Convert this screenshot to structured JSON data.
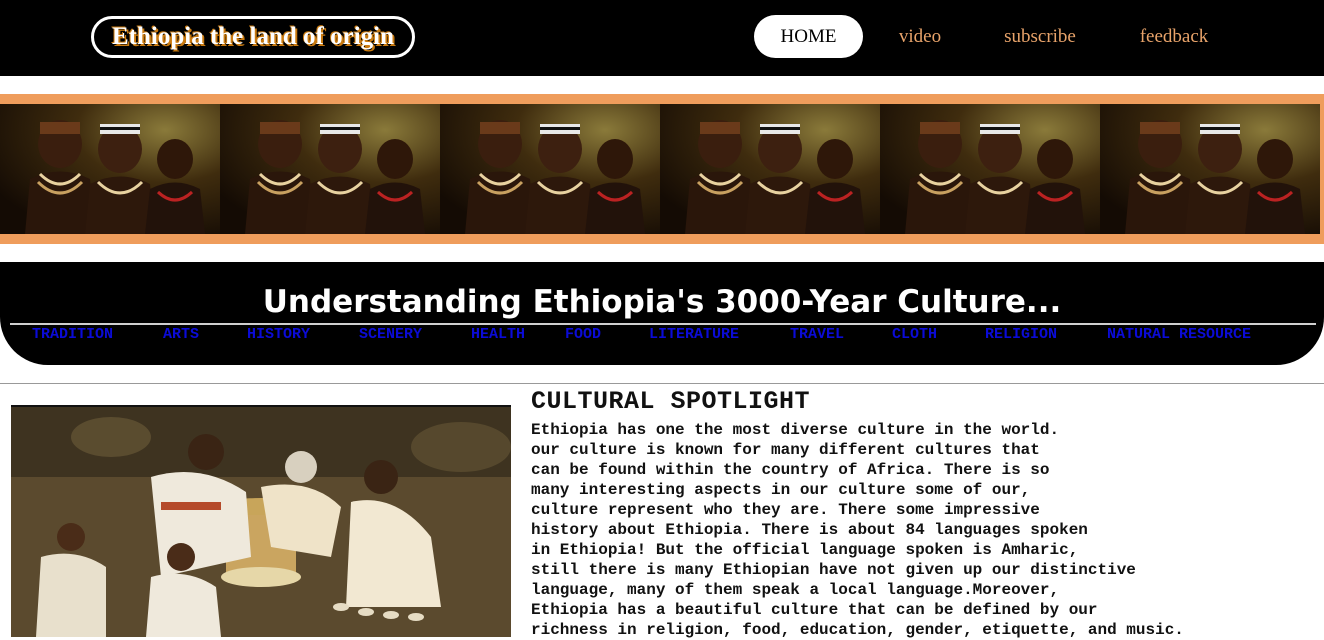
{
  "site": {
    "logo_text": "Ethiopia the land of origin"
  },
  "nav": {
    "items": [
      {
        "label": "HOME",
        "active": true
      },
      {
        "label": "video",
        "active": false
      },
      {
        "label": "subscribe",
        "active": false
      },
      {
        "label": "feedback",
        "active": false
      }
    ]
  },
  "culture": {
    "title": "Understanding Ethiopia's 3000-Year Culture...",
    "categories": [
      "TRADITION",
      "ARTS",
      "HISTORY",
      "SCENERY",
      "HEALTH",
      "FOOD",
      "LITERATURE",
      "TRAVEL",
      "CLOTH",
      "RELIGION",
      "NATURAL RESOURCE"
    ]
  },
  "spotlight": {
    "title": "CULTURAL SPOTLIGHT",
    "lines": [
      "Ethiopia has one the most diverse culture in the world.",
      "our culture is known for many different cultures that",
      "can be found within the country of Africa. There is so",
      "many interesting aspects in our culture some of our,",
      "culture represent who they are. There some impressive",
      "history about Ethiopia. There is about 84 languages spoken",
      "in Ethiopia! But the official language spoken is Amharic,",
      "still there is many Ethiopian have not given up our distinctive",
      "language, many of them speak a local language.Moreover,",
      "Ethiopia has a beautiful culture that can be defined by our",
      "richness in religion, food, education, gender, etiquette, and music."
    ]
  },
  "colors": {
    "nav_link": "#e8a36a",
    "banner_border": "#ef9d5c",
    "category_link": "#0b0bd6"
  }
}
